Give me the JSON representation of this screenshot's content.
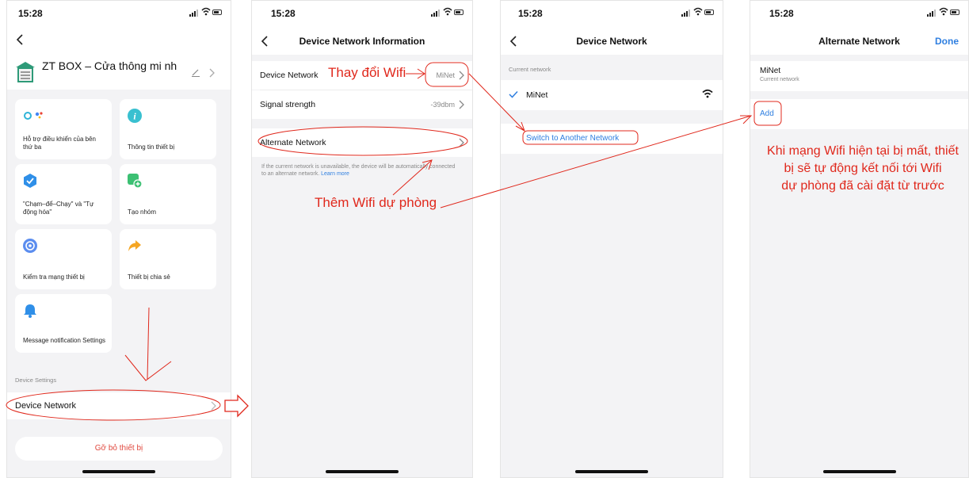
{
  "status": {
    "time": "15:28"
  },
  "screen1": {
    "device_name": "ZT BOX – Cửa thông mi nh",
    "tiles": [
      {
        "label": "Hỗ trợ điều khiển của bên thứ ba",
        "icon": "assistant-icon"
      },
      {
        "label": "Thông tin thiết bị",
        "icon": "info-icon"
      },
      {
        "label": "\"Chạm–để–Chạy\" và \"Tự động hóa\"",
        "icon": "automation-icon"
      },
      {
        "label": "Tạo nhóm",
        "icon": "create-group-icon"
      },
      {
        "label": "Kiểm tra mạng thiết bị",
        "icon": "network-check-icon"
      },
      {
        "label": "Thiết bị chia sẻ",
        "icon": "share-icon"
      },
      {
        "label": "Message notification Settings",
        "icon": "bell-icon"
      }
    ],
    "section_label": "Device Settings",
    "device_network_label": "Device Network",
    "remove_label": "Gỡ bỏ thiết bị"
  },
  "screen2": {
    "title": "Device Network Information",
    "device_network_label": "Device Network",
    "device_network_value": "MiNet",
    "signal_label": "Signal strength",
    "signal_value": "-39dbm",
    "alternate_label": "Alternate Network",
    "hint_text": "If the current network is unavailable, the device will be automatically connected to an alternate network.",
    "hint_link": "Learn more"
  },
  "screen3": {
    "title": "Device Network",
    "current_label": "Current network",
    "network_name": "MiNet",
    "switch_label": "Switch to Another Network"
  },
  "screen4": {
    "title": "Alternate Network",
    "done_label": "Done",
    "network_name": "MiNet",
    "network_sub": "Current network",
    "add_label": "Add"
  },
  "annotations": {
    "change_wifi": "Thay đổi Wifi",
    "add_backup": "Thêm Wifi dự phòng",
    "note_line1": "Khi mạng Wifi hiện tại bị mất, thiết",
    "note_line2": "bị sẽ tự động kết nối tới Wifi",
    "note_line3": "dự phòng đã cài đặt từ trước"
  },
  "colors": {
    "accent": "#2f7fe0",
    "annotation": "#e0281c",
    "danger": "#e0483e",
    "background": "#f3f3f5"
  }
}
